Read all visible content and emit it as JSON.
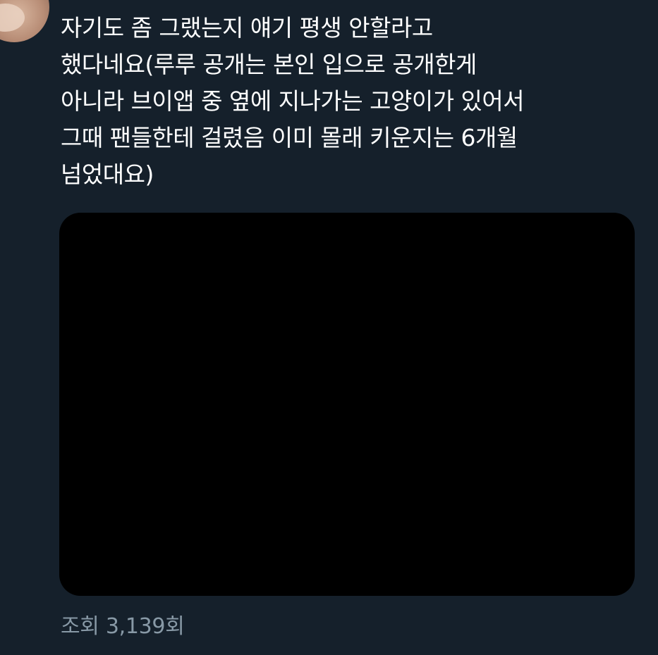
{
  "tweet": {
    "text_lines": [
      "자기도 좀 그랬는지 얘기 평생 안할라고",
      "했다네요(루루 공개는 본인 입으로 공개한게",
      "아니라 브이앱 중 옆에 지나가는 고양이가 있어서",
      "그때 팬들한테 걸렸음 이미 몰래 키운지는 6개월",
      "넘었대요)"
    ],
    "views_label": "조회 3,139회"
  },
  "colors": {
    "background": "#15202b",
    "text": "#ffffff",
    "secondary_text": "#8899a6",
    "media": "#000000"
  }
}
